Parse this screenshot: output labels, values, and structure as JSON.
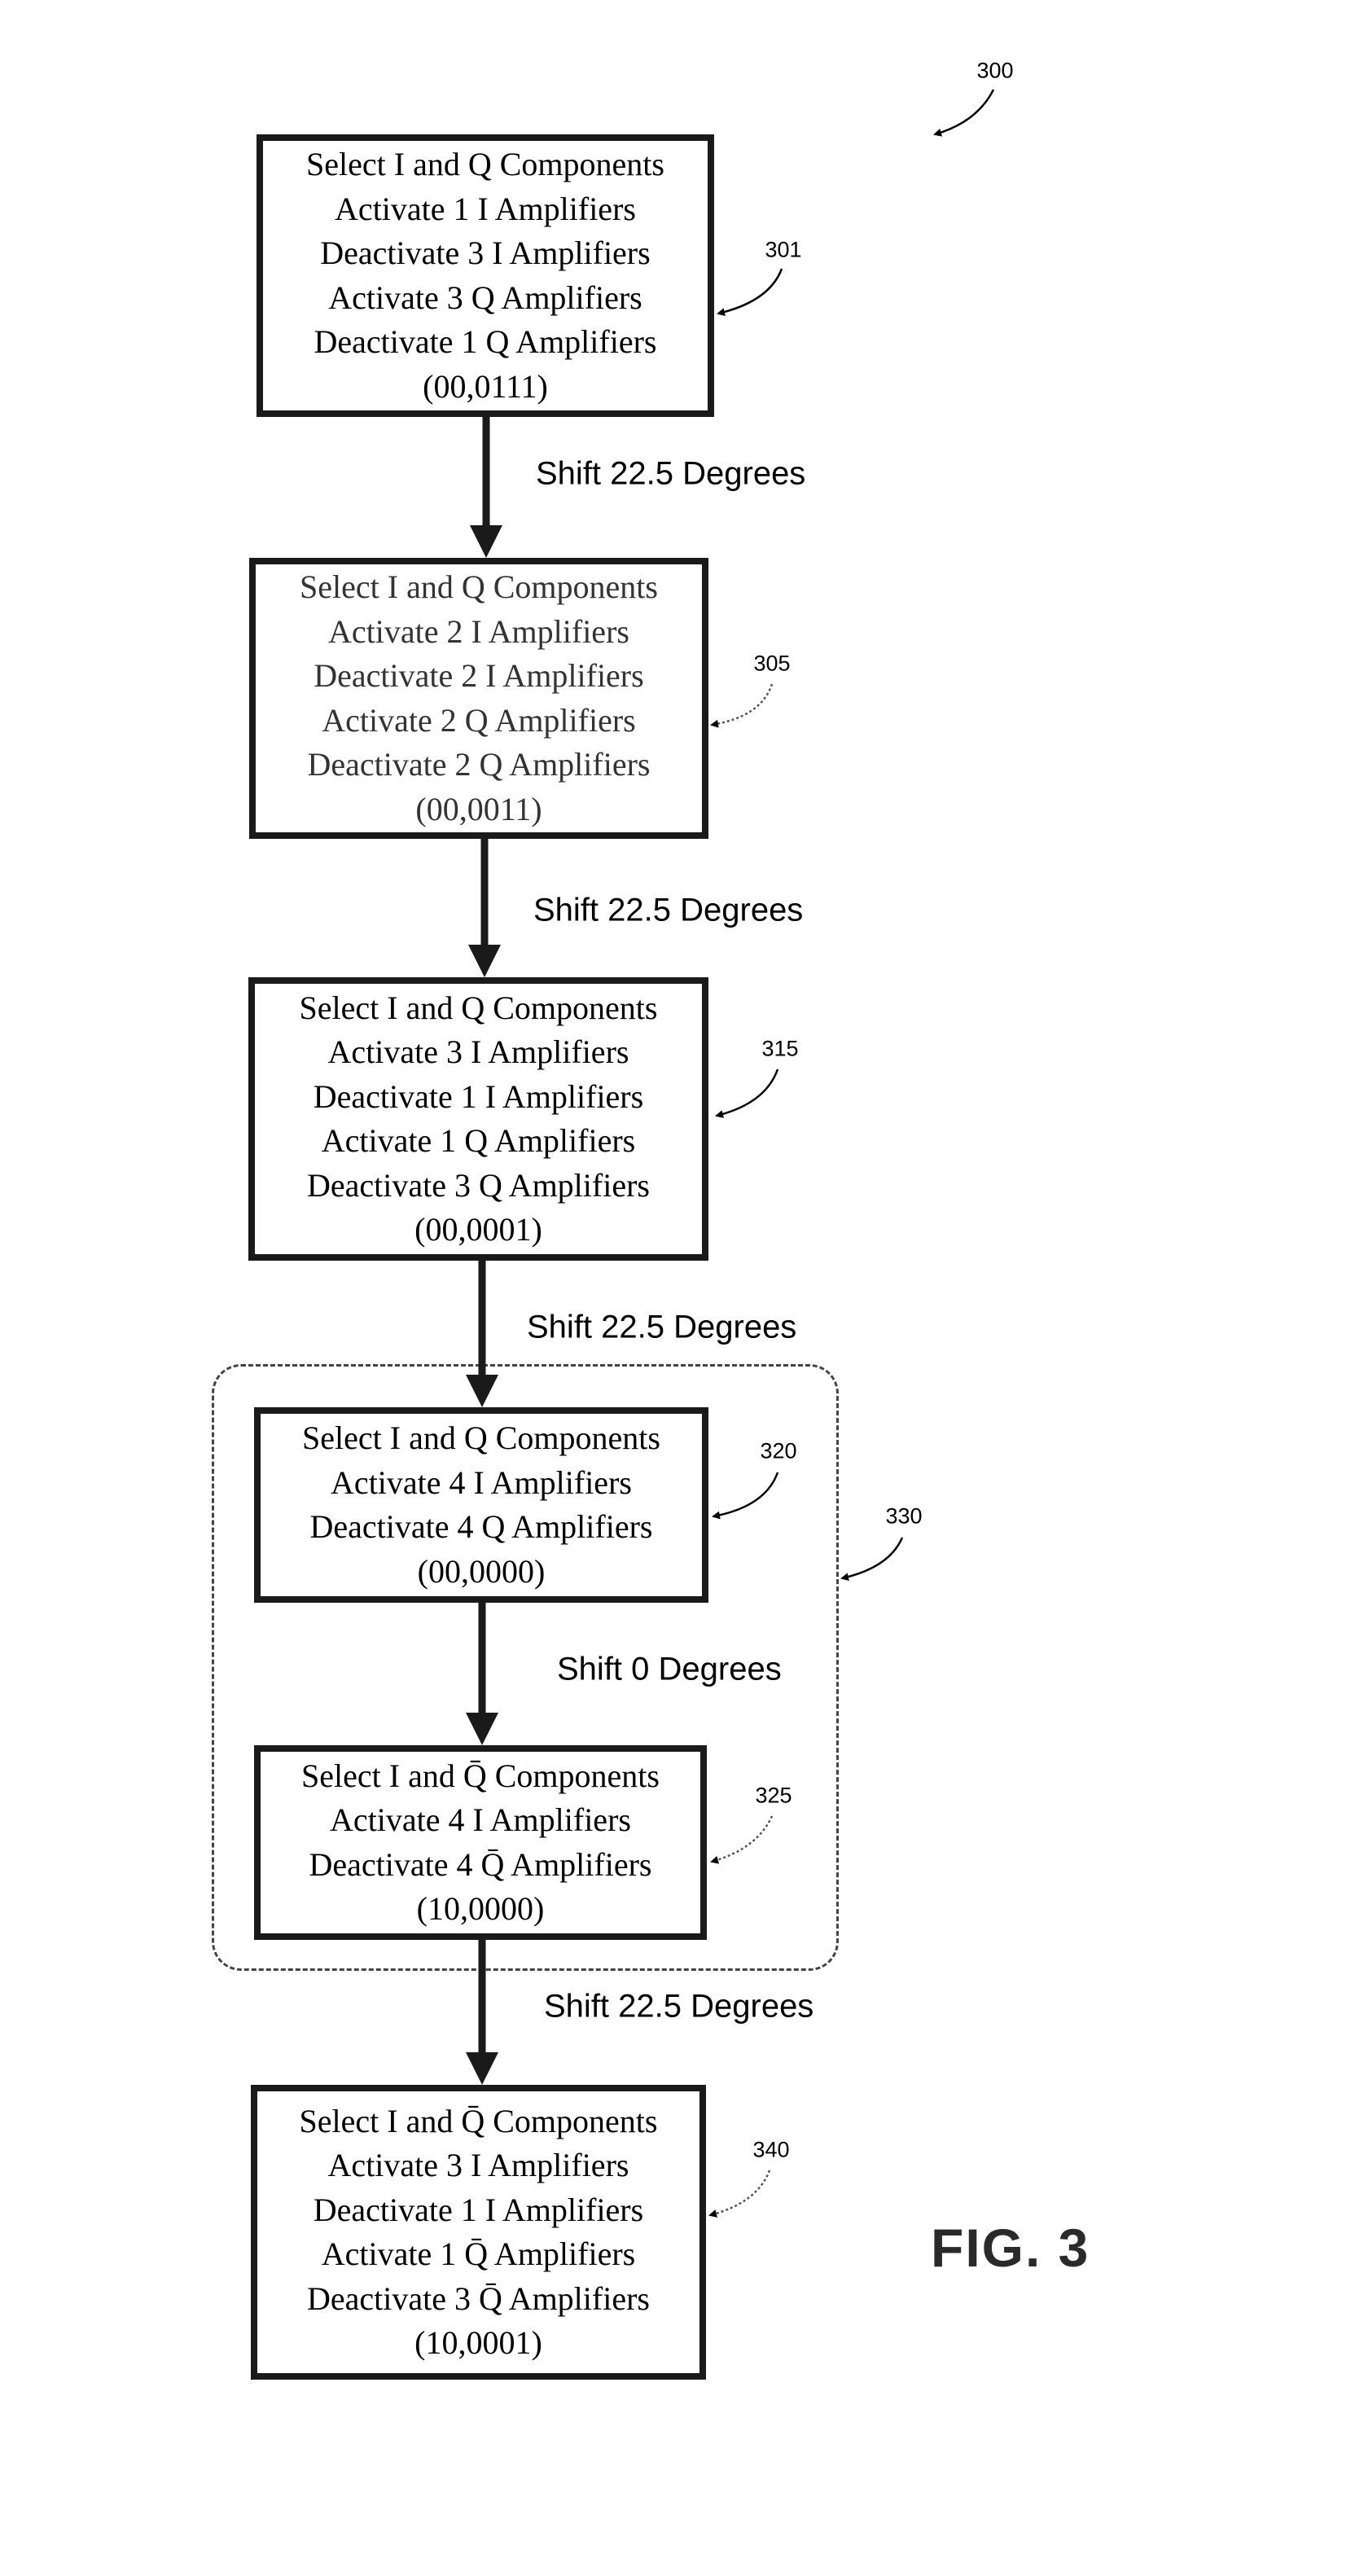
{
  "figure": {
    "number_label": "300",
    "caption": "FIG. 3"
  },
  "steps": [
    {
      "ref": "301",
      "lines": [
        "Select I and Q Components",
        "Activate 1 I Amplifiers",
        "Deactivate 3 I Amplifiers",
        "Activate 3 Q Amplifiers",
        "Deactivate 1 Q Amplifiers",
        "(00,0111)"
      ]
    },
    {
      "ref": "305",
      "lines": [
        "Select I and Q Components",
        "Activate 2 I Amplifiers",
        "Deactivate 2 I Amplifiers",
        "Activate 2 Q Amplifiers",
        "Deactivate 2 Q Amplifiers",
        "(00,0011)"
      ]
    },
    {
      "ref": "315",
      "lines": [
        "Select I and Q Components",
        "Activate 3 I Amplifiers",
        "Deactivate 1 I Amplifiers",
        "Activate 1 Q Amplifiers",
        "Deactivate 3 Q Amplifiers",
        "(00,0001)"
      ]
    },
    {
      "ref": "320",
      "lines": [
        "Select I and Q Components",
        "Activate 4 I Amplifiers",
        "Deactivate 4 Q Amplifiers",
        "(00,0000)"
      ]
    },
    {
      "ref": "325",
      "lines": [
        "Select I and Q̄ Components",
        "Activate 4 I Amplifiers",
        "Deactivate 4 Q̄ Amplifiers",
        "(10,0000)"
      ]
    },
    {
      "ref": "340",
      "lines": [
        "Select I and Q̄ Components",
        "Activate 3 I Amplifiers",
        "Deactivate 1 I Amplifiers",
        "Activate 1 Q̄ Amplifiers",
        "Deactivate 3 Q̄ Amplifiers",
        "(10,0001)"
      ]
    }
  ],
  "group": {
    "ref": "330"
  },
  "transitions": [
    {
      "label": "Shift 22.5 Degrees"
    },
    {
      "label": "Shift 22.5 Degrees"
    },
    {
      "label": "Shift 22.5 Degrees"
    },
    {
      "label": "Shift 0 Degrees"
    },
    {
      "label": "Shift 22.5 Degrees"
    }
  ]
}
